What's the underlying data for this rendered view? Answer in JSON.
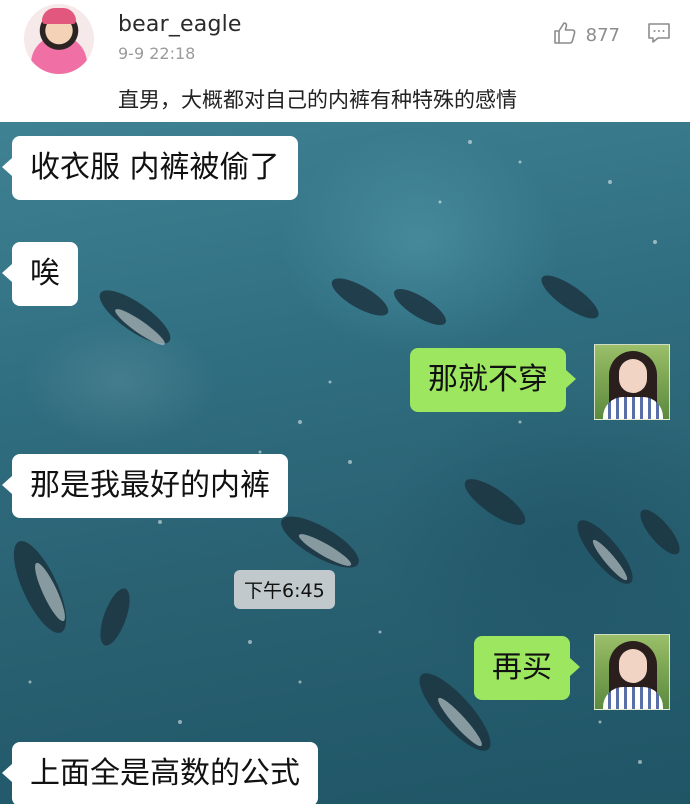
{
  "post": {
    "username": "bear_eagle",
    "time": "9-9 22:18",
    "likes": "877",
    "text": "直男，大概都对自己的内裤有种特殊的感情"
  },
  "chat": {
    "messages": [
      {
        "side": "left",
        "text": "收衣服  内裤被偷了"
      },
      {
        "side": "left",
        "text": "唉"
      },
      {
        "side": "right",
        "text": "那就不穿"
      },
      {
        "side": "left",
        "text": "那是我最好的内裤"
      },
      {
        "side": "right",
        "text": "再买"
      },
      {
        "side": "left",
        "text": "上面全是高数的公式"
      }
    ],
    "timestamp": "下午6:45"
  },
  "colors": {
    "sent_bubble": "#9de660",
    "received_bubble": "#ffffff",
    "chat_background": "#2f6e80"
  },
  "icons": {
    "like": "thumbs-up-icon",
    "comment": "comment-icon"
  }
}
